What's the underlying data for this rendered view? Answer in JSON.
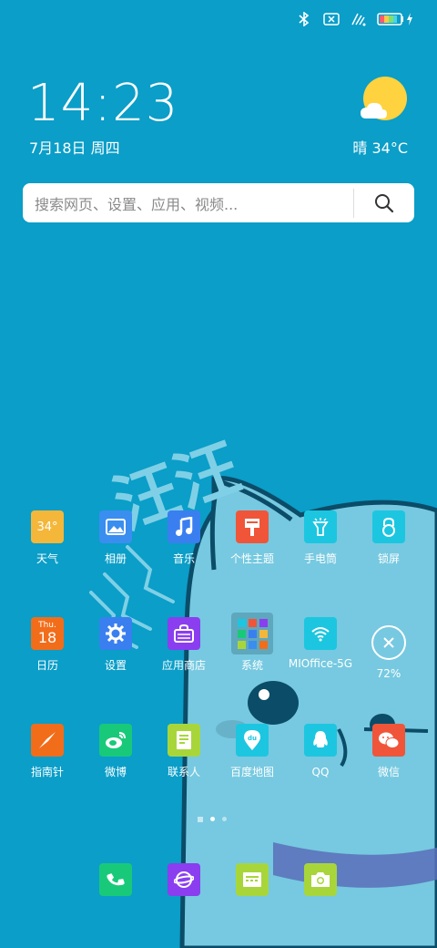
{
  "status_bar": {
    "icons": [
      "bluetooth-icon",
      "sim-disabled-icon",
      "signal-icon",
      "battery-icon",
      "charging-icon"
    ]
  },
  "clock": {
    "time": "14:23",
    "date": "7月18日 周四"
  },
  "weather": {
    "icon": "sunny-cloud-icon",
    "text": "晴  34°C"
  },
  "search": {
    "placeholder": "搜索网页、设置、应用、视频..."
  },
  "apps": [
    {
      "label": "天气",
      "icon": "weather-icon",
      "color": "#f4b73a",
      "glyph": "34°"
    },
    {
      "label": "相册",
      "icon": "gallery-icon",
      "color": "#3a8ef0"
    },
    {
      "label": "音乐",
      "icon": "music-icon",
      "color": "#3a7ff0"
    },
    {
      "label": "个性主题",
      "icon": "themes-icon",
      "color": "#f0553a"
    },
    {
      "label": "手电筒",
      "icon": "flashlight-icon",
      "color": "#1cc6e0"
    },
    {
      "label": "锁屏",
      "icon": "lock-icon",
      "color": "#1cc6e0"
    },
    {
      "label": "日历",
      "icon": "calendar-icon",
      "color": "#f26d1a",
      "glyph_top": "Thu.",
      "glyph": "18"
    },
    {
      "label": "设置",
      "icon": "settings-icon",
      "color": "#3a7ff0"
    },
    {
      "label": "应用商店",
      "icon": "app-store-icon",
      "color": "#8a3ef0"
    },
    {
      "label": "系统",
      "icon": "system-folder-icon",
      "color": "#5fa7bd"
    },
    {
      "label": "MIOffice-5G",
      "icon": "wifi-icon",
      "color": "#1cc6e0"
    },
    {
      "label": "72%",
      "icon": "cleaner-icon",
      "color": "transparent"
    },
    {
      "label": "指南针",
      "icon": "compass-icon",
      "color": "#f26d1a"
    },
    {
      "label": "微博",
      "icon": "weibo-icon",
      "color": "#19c97a"
    },
    {
      "label": "联系人",
      "icon": "contacts-icon",
      "color": "#a8d63a"
    },
    {
      "label": "百度地图",
      "icon": "baidu-map-icon",
      "color": "#1cc6e0"
    },
    {
      "label": "QQ",
      "icon": "qq-icon",
      "color": "#1cc6e0"
    },
    {
      "label": "微信",
      "icon": "wechat-icon",
      "color": "#f0553a"
    }
  ],
  "dock": [
    {
      "icon": "phone-icon",
      "color": "#19c97a"
    },
    {
      "icon": "browser-icon",
      "color": "#8a3ef0"
    },
    {
      "icon": "messages-icon",
      "color": "#a8d63a"
    },
    {
      "icon": "camera-icon",
      "color": "#a8d63a"
    }
  ],
  "wallpaper": {
    "text": "汪汪"
  }
}
